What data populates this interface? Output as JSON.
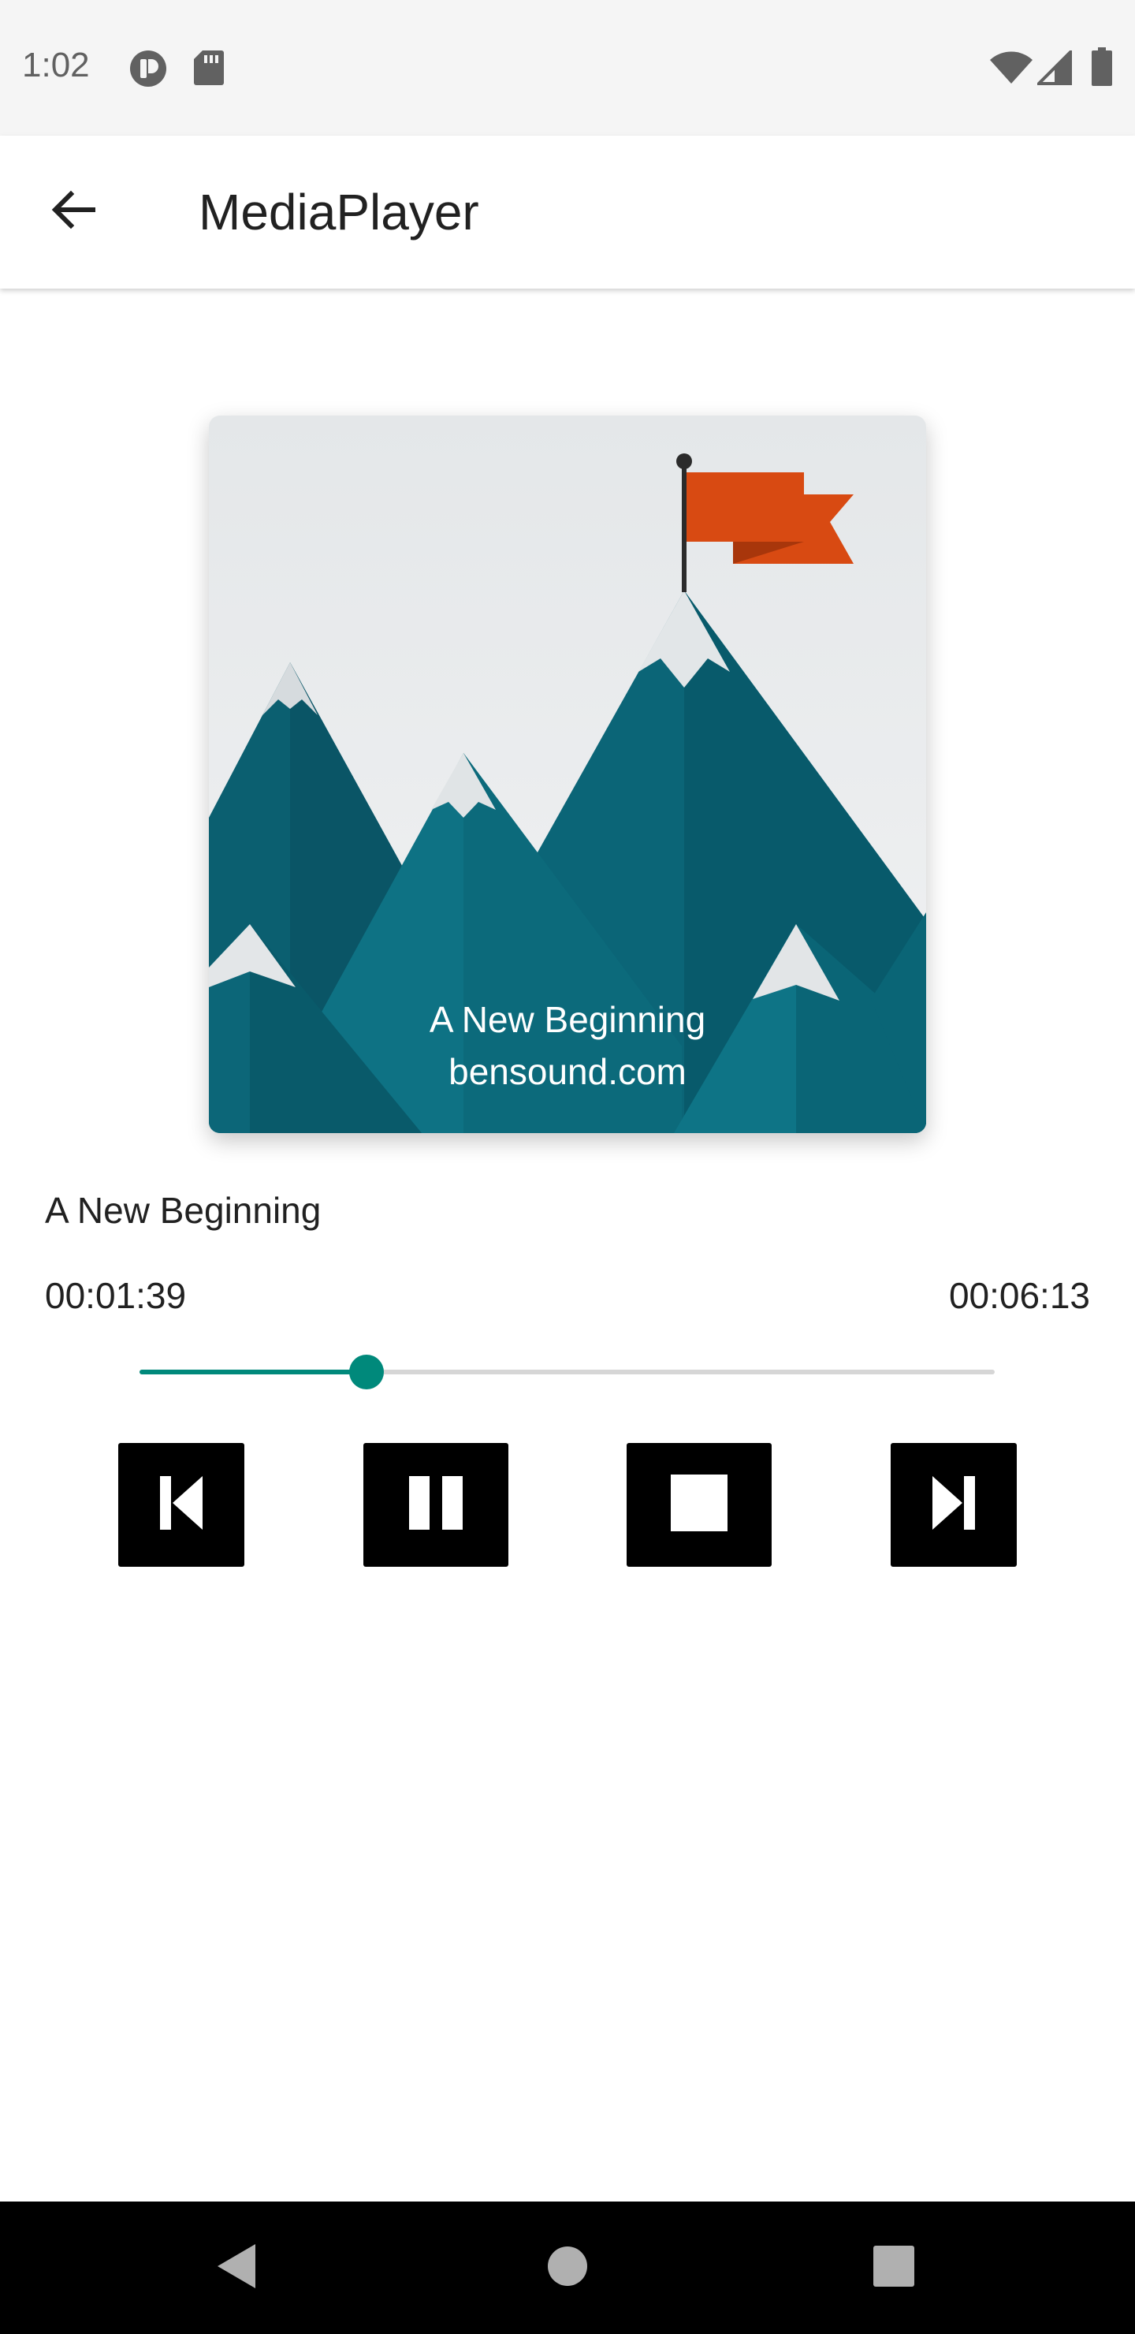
{
  "status_bar": {
    "time": "1:02",
    "icons": [
      "media-session-icon",
      "sd-card-icon",
      "wifi-icon",
      "cell-signal-icon",
      "battery-icon"
    ]
  },
  "app_bar": {
    "title": "MediaPlayer",
    "back_icon": "arrow-back-icon"
  },
  "album": {
    "caption_line1": "A New Beginning",
    "caption_line2": "bensound.com"
  },
  "player": {
    "song_title": "A New Beginning",
    "current_time": "00:01:39",
    "total_time": "00:06:13",
    "progress": 0.265,
    "accent_color": "#00897b"
  },
  "controls": [
    {
      "name": "previous",
      "icon": "skip-previous-icon"
    },
    {
      "name": "pause",
      "icon": "pause-icon"
    },
    {
      "name": "stop",
      "icon": "stop-icon"
    },
    {
      "name": "next",
      "icon": "skip-next-icon"
    }
  ],
  "nav_bar": {
    "icons": [
      "nav-back-icon",
      "nav-home-icon",
      "nav-recents-icon"
    ]
  }
}
